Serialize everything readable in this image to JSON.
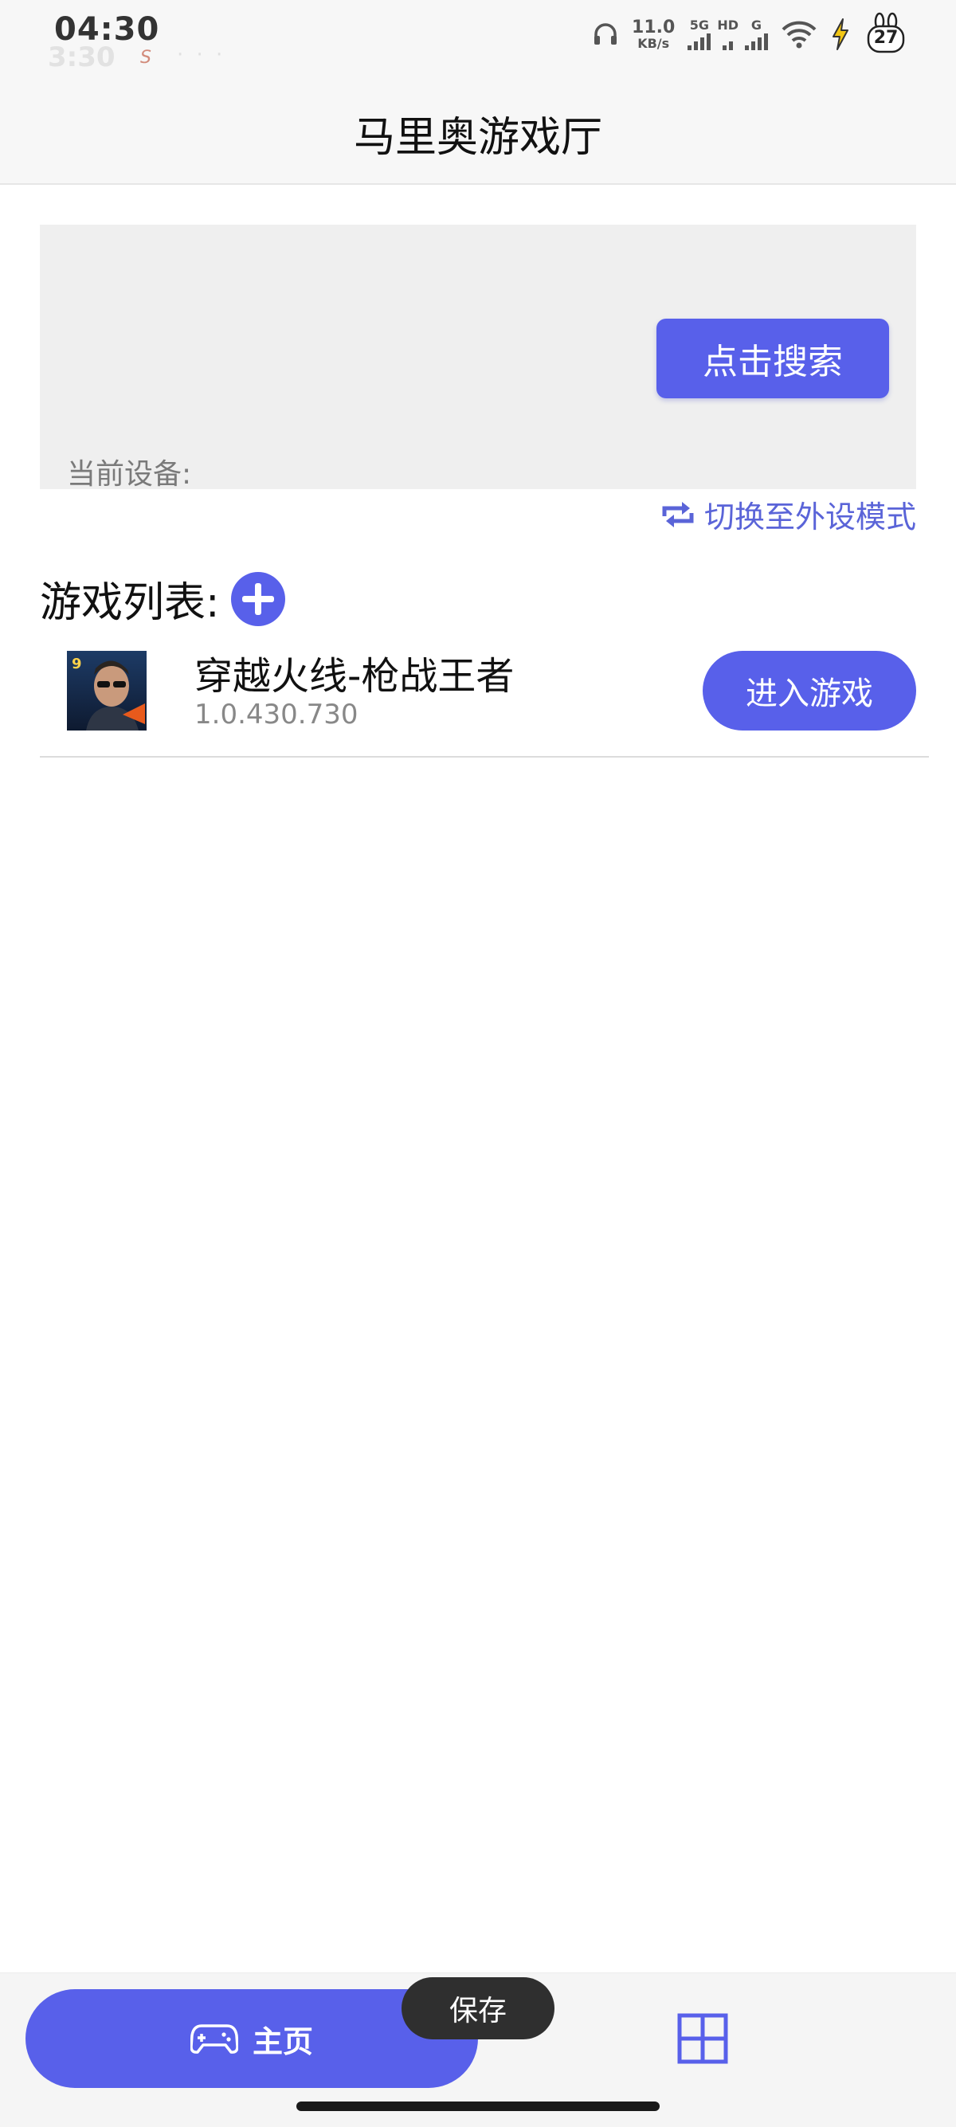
{
  "status_bar": {
    "time": "04:30",
    "ghost_time": "3:30",
    "ghost_s": "S",
    "ghost_dots": "· · ·",
    "speed_value": "11.0",
    "speed_unit": "KB/s",
    "net_labels": [
      "5G",
      "HD",
      "G"
    ],
    "battery": "27"
  },
  "header": {
    "title": "马里奥游戏厅"
  },
  "device_panel": {
    "search_button": "点击搜索",
    "current_device_label": "当前设备:",
    "switch_mode_label": "切换至外设模式"
  },
  "game_list": {
    "title": "游戏列表:",
    "items": [
      {
        "name": "穿越火线-枪战王者",
        "version": "1.0.430.730",
        "button_label": "进入游戏"
      }
    ]
  },
  "bottom_nav": {
    "home_label": "主页"
  },
  "toast": {
    "label": "保存"
  },
  "colors": {
    "accent": "#5860ea",
    "toast_bg": "#2f2f2f"
  },
  "icons": [
    "headphone-icon",
    "wifi-icon",
    "bolt-icon",
    "battery-icon",
    "repeat-icon",
    "plus-icon",
    "gamepad-icon",
    "grid-icon"
  ]
}
